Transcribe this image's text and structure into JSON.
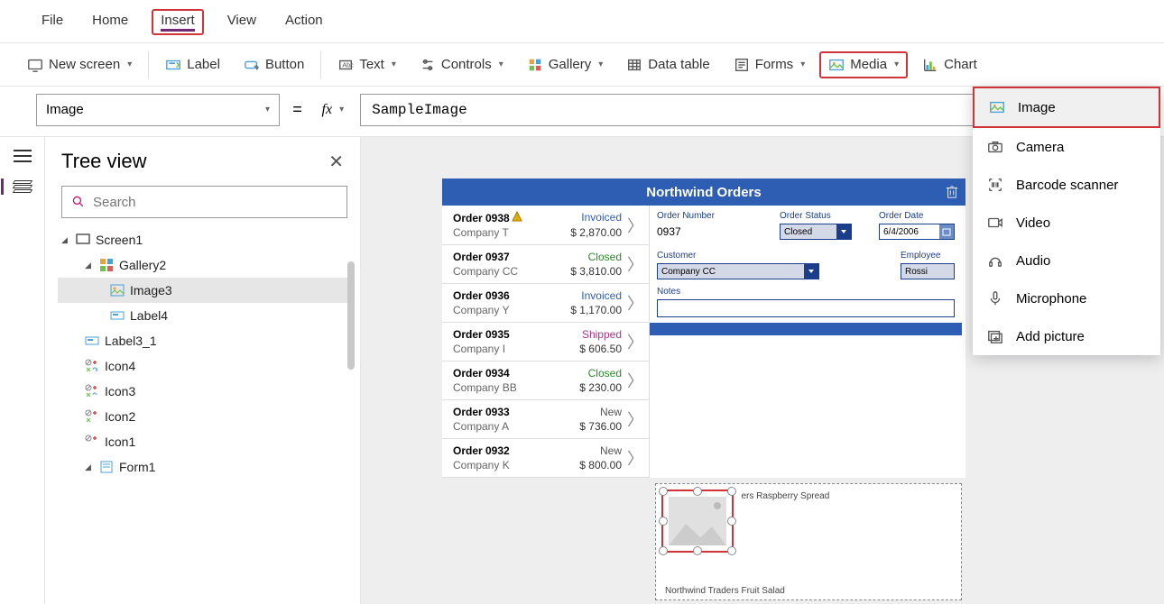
{
  "menubar": {
    "file": "File",
    "home": "Home",
    "insert": "Insert",
    "view": "View",
    "action": "Action"
  },
  "toolbar": {
    "newscreen": "New screen",
    "label": "Label",
    "button": "Button",
    "text": "Text",
    "controls": "Controls",
    "gallery": "Gallery",
    "datatable": "Data table",
    "forms": "Forms",
    "media": "Media",
    "chart": "Chart"
  },
  "formula": {
    "property": "Image",
    "value": "SampleImage",
    "fx": "fx"
  },
  "treepanel": {
    "title": "Tree view",
    "search_placeholder": "Search",
    "items": {
      "screen1": "Screen1",
      "gallery2": "Gallery2",
      "image3": "Image3",
      "label4": "Label4",
      "label3_1": "Label3_1",
      "icon4": "Icon4",
      "icon3": "Icon3",
      "icon2": "Icon2",
      "icon1": "Icon1",
      "form1": "Form1"
    }
  },
  "app": {
    "title": "Northwind Orders",
    "gallery": [
      {
        "order": "Order 0938",
        "company": "Company T",
        "status": "Invoiced",
        "price": "$ 2,870.00",
        "warn": true
      },
      {
        "order": "Order 0937",
        "company": "Company CC",
        "status": "Closed",
        "price": "$ 3,810.00"
      },
      {
        "order": "Order 0936",
        "company": "Company Y",
        "status": "Invoiced",
        "price": "$ 1,170.00"
      },
      {
        "order": "Order 0935",
        "company": "Company I",
        "status": "Shipped",
        "price": "$ 606.50"
      },
      {
        "order": "Order 0934",
        "company": "Company BB",
        "status": "Closed",
        "price": "$ 230.00"
      },
      {
        "order": "Order 0933",
        "company": "Company A",
        "status": "New",
        "price": "$ 736.00"
      },
      {
        "order": "Order 0932",
        "company": "Company K",
        "status": "New",
        "price": "$ 800.00"
      }
    ],
    "form": {
      "labels": {
        "ordernum": "Order Number",
        "orderstatus": "Order Status",
        "orderdate": "Order Date",
        "customer": "Customer",
        "employee": "Employee",
        "notes": "Notes"
      },
      "values": {
        "ordernum": "0937",
        "orderstatus": "Closed",
        "orderdate": "6/4/2006",
        "customer": "Company CC",
        "employee": "Rossi"
      }
    },
    "detail": {
      "item1": "ers Raspberry Spread",
      "item2": "Northwind Traders Fruit Salad"
    }
  },
  "media_dd": {
    "image": "Image",
    "camera": "Camera",
    "barcode": "Barcode scanner",
    "video": "Video",
    "audio": "Audio",
    "microphone": "Microphone",
    "addpicture": "Add picture"
  }
}
